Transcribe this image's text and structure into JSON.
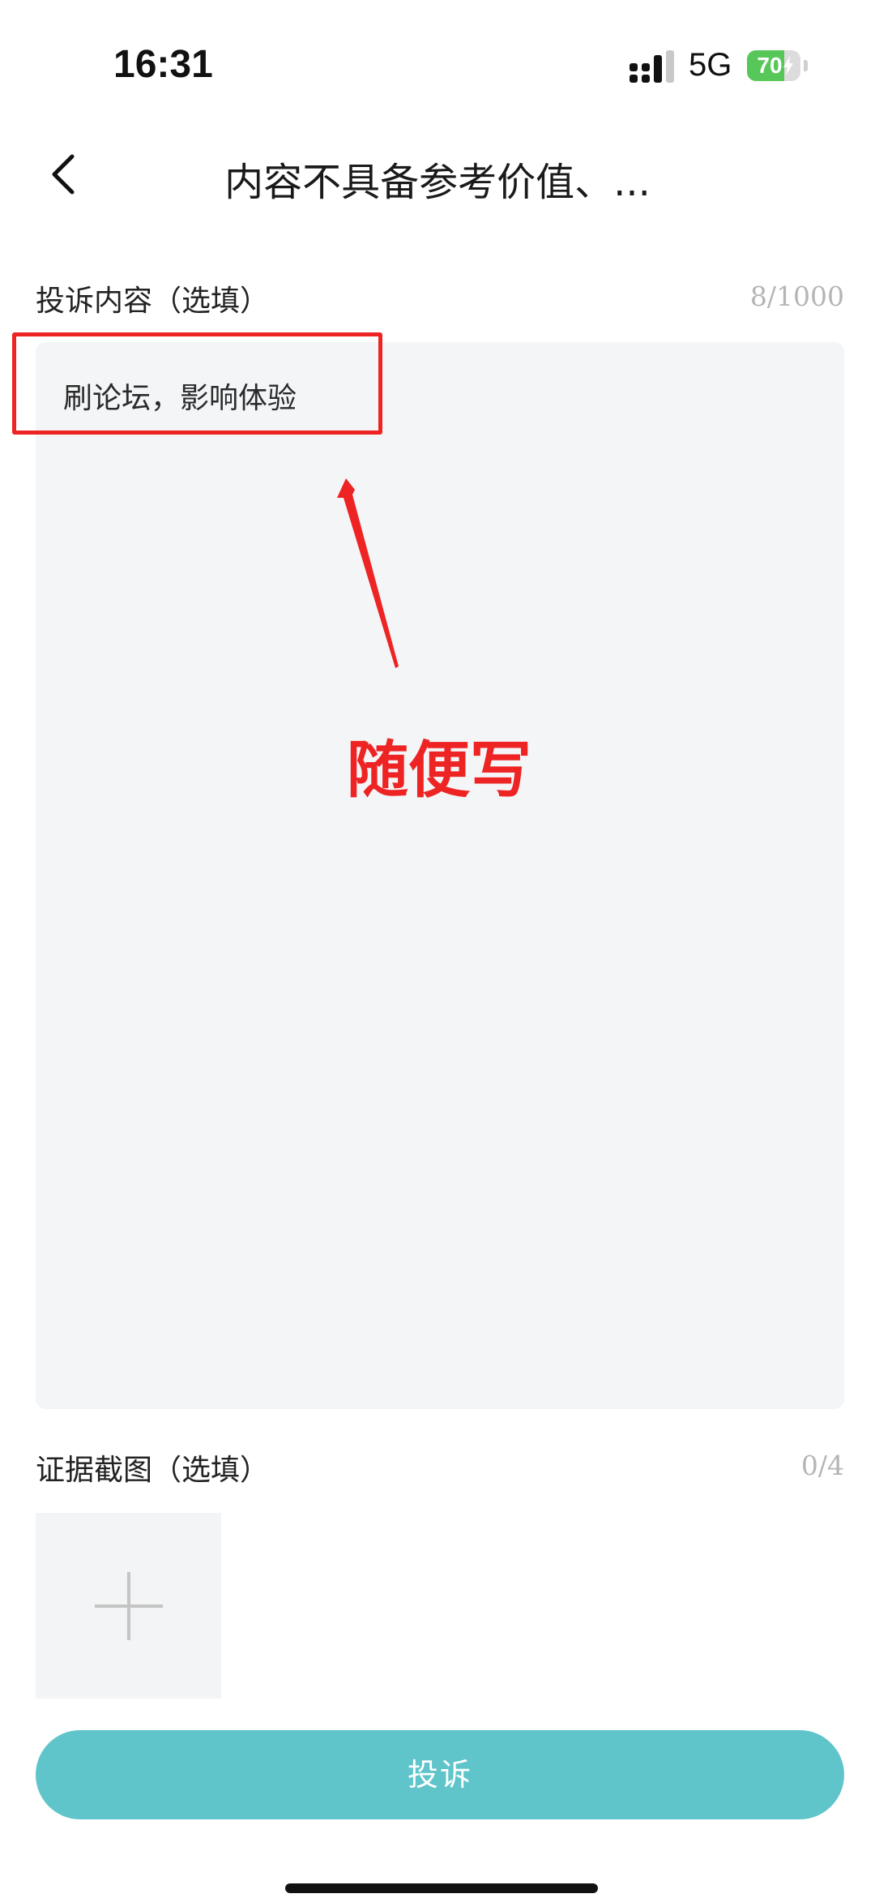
{
  "status_bar": {
    "time": "16:31",
    "network": "5G",
    "battery": "70",
    "battery_level": 0.7,
    "battery_color": "#58c75a"
  },
  "header": {
    "back_icon": "chevron-left-icon",
    "title": "内容不具备参考价值、..."
  },
  "complaint": {
    "label": "投诉内容（选填）",
    "count": "8/1000",
    "value": "刷论坛，影响体验"
  },
  "annotation": {
    "note": "随便写",
    "color": "#ee2323"
  },
  "evidence": {
    "label": "证据截图（选填）",
    "count": "0/4",
    "add_icon": "plus-icon"
  },
  "submit": {
    "label": "投诉",
    "color": "#5fc5cb"
  }
}
